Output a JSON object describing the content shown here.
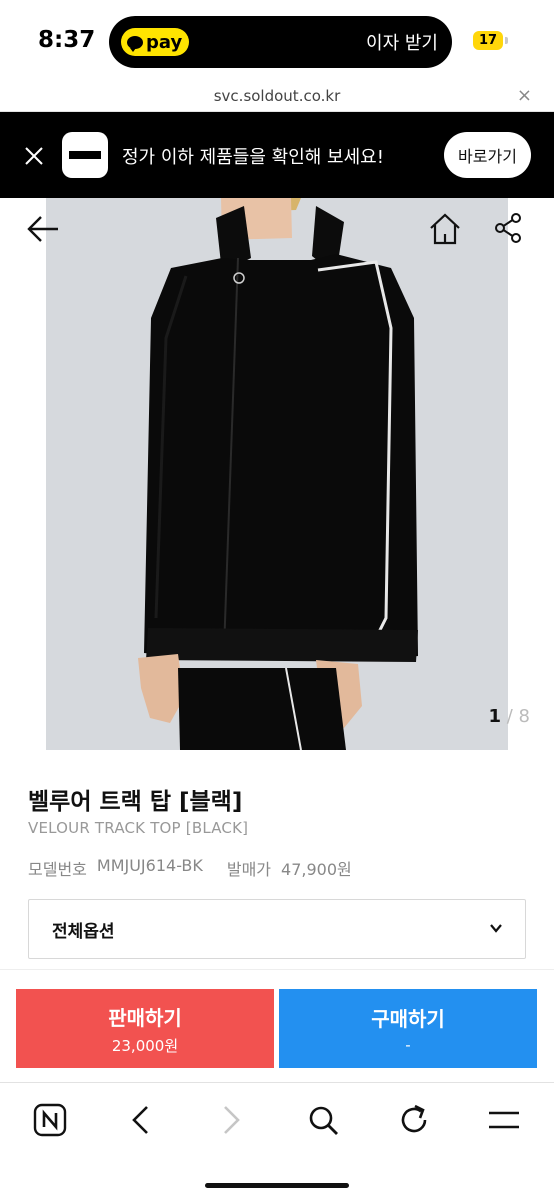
{
  "status_bar": {
    "time": "8:37",
    "pay_label": "pay",
    "island_text": "이자 받기",
    "battery_level": "17"
  },
  "url_bar": {
    "url": "svc.soldout.co.kr",
    "close_label": "×"
  },
  "banner": {
    "text": "정가 이하 제품들을 확인해 보세요!",
    "button_label": "바로가기"
  },
  "gallery": {
    "current": "1",
    "separator": "/",
    "total": "8"
  },
  "product": {
    "title": "벨루어 트랙 탑 [블랙]",
    "subtitle": "VELOUR TRACK TOP [BLACK]",
    "model_label": "모델번호",
    "model_value": "MMJUJ614-BK",
    "release_price_label": "발매가",
    "release_price_value": "47,900원"
  },
  "options": {
    "selected": "전체옵션"
  },
  "actions": {
    "sell_label": "판매하기",
    "sell_price": "23,000원",
    "buy_label": "구매하기",
    "buy_price": "-"
  },
  "colors": {
    "sell": "#f25250",
    "buy": "#2390f0",
    "pay_badge": "#ffe400",
    "battery": "#ffd60a"
  },
  "toolbar": {
    "icons": [
      "naver-home-icon",
      "back-icon",
      "forward-icon",
      "search-icon",
      "refresh-icon",
      "menu-icon"
    ]
  }
}
